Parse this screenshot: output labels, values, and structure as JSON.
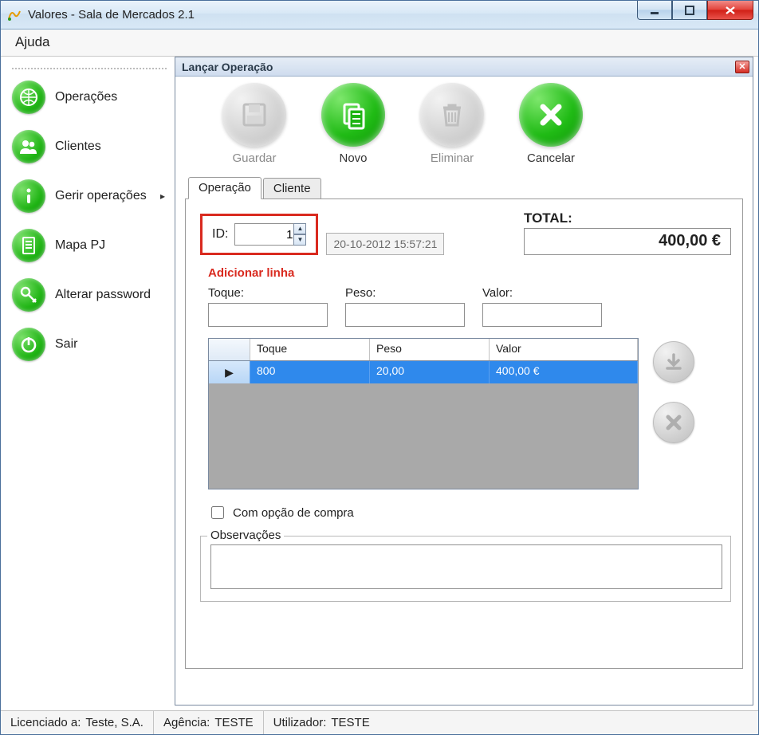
{
  "window": {
    "title": "Valores - Sala de Mercados 2.1"
  },
  "menu": {
    "ajuda": "Ajuda"
  },
  "sidebar": {
    "items": [
      {
        "label": "Operações"
      },
      {
        "label": "Clientes"
      },
      {
        "label": "Gerir operações"
      },
      {
        "label": "Mapa PJ"
      },
      {
        "label": "Alterar password"
      },
      {
        "label": "Sair"
      }
    ]
  },
  "inner": {
    "title": "Lançar Operação"
  },
  "toolbar": {
    "guardar": "Guardar",
    "novo": "Novo",
    "eliminar": "Eliminar",
    "cancelar": "Cancelar"
  },
  "tabs": {
    "operacao": "Operação",
    "cliente": "Cliente"
  },
  "op": {
    "id_label": "ID:",
    "id_value": "1",
    "datetime": "20-10-2012 15:57:21",
    "total_label": "TOTAL:",
    "total_value": "400,00 €",
    "addline": "Adicionar linha",
    "toque_label": "Toque:",
    "peso_label": "Peso:",
    "valor_label": "Valor:",
    "toque_value": "",
    "peso_value": "",
    "valor_value": "",
    "grid": {
      "headers": {
        "toque": "Toque",
        "peso": "Peso",
        "valor": "Valor"
      },
      "rows": [
        {
          "toque": "800",
          "peso": "20,00",
          "valor": "400,00 €"
        }
      ]
    },
    "com_opcao": "Com opção de compra",
    "obs_label": "Observações",
    "obs_value": ""
  },
  "status": {
    "licenciado_label": "Licenciado a:",
    "licenciado_value": "Teste, S.A.",
    "agencia_label": "Agência:",
    "agencia_value": "TESTE",
    "utilizador_label": "Utilizador:",
    "utilizador_value": "TESTE"
  }
}
